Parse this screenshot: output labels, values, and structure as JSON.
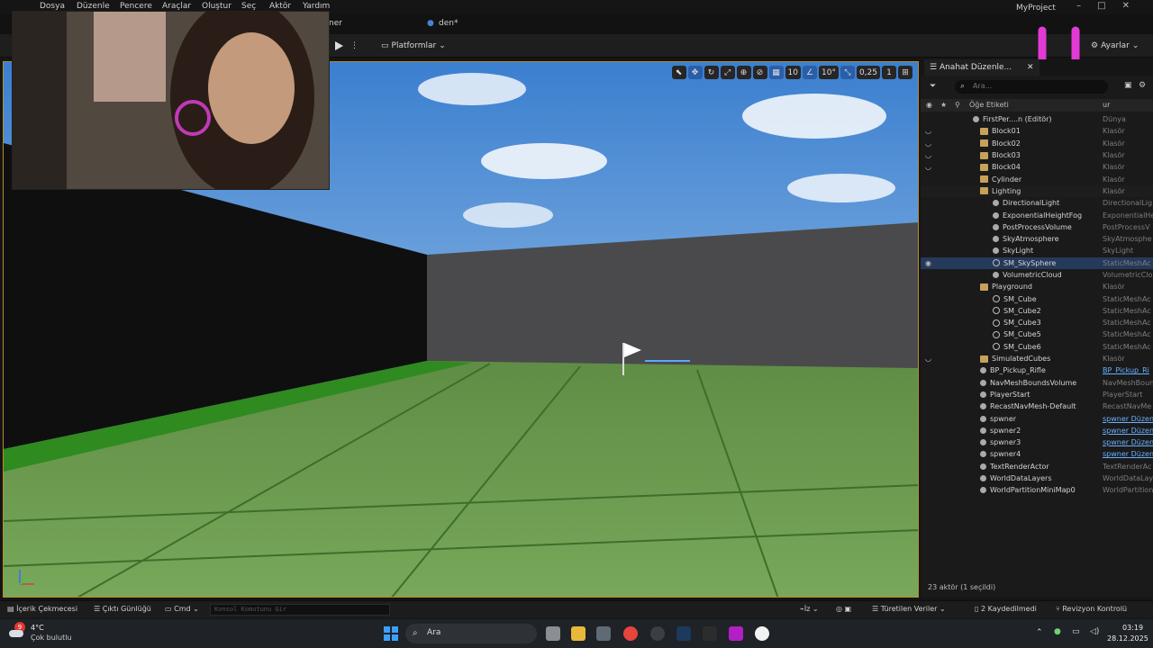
{
  "menu": {
    "items": [
      "Dosya",
      "Düzenle",
      "Pencere",
      "Araçlar",
      "Oluştur",
      "Seç",
      "Aktör",
      "Yardım"
    ],
    "project": "MyProject"
  },
  "tabs": {
    "map_tab": "ner",
    "level_tab": "den*"
  },
  "toolbar": {
    "platforms": "Platformlar",
    "settings": "Ayarlar"
  },
  "viewport": {
    "grid_value": "10",
    "angle_value": "10°",
    "scale_value": "0,25",
    "camera_speed": "1"
  },
  "outliner": {
    "tab_title": "Anahat Düzenle...",
    "search_placeholder": "Ara...",
    "col_label": "Öğe Etiketi",
    "col_type": "ur",
    "rows": [
      {
        "label": "FirstPer....n (Editör)",
        "type": "Dünya",
        "indent": 0,
        "icon": "world"
      },
      {
        "label": "Block01",
        "type": "Klasör",
        "indent": 1,
        "icon": "folder"
      },
      {
        "label": "Block02",
        "type": "Klasör",
        "indent": 1,
        "icon": "folder"
      },
      {
        "label": "Block03",
        "type": "Klasör",
        "indent": 1,
        "icon": "folder"
      },
      {
        "label": "Block04",
        "type": "Klasör",
        "indent": 1,
        "icon": "folder"
      },
      {
        "label": "Cylinder",
        "type": "Klasör",
        "indent": 1,
        "icon": "folder"
      },
      {
        "label": "Lighting",
        "type": "Klasör",
        "indent": 1,
        "icon": "folder"
      },
      {
        "label": "DirectionalLight",
        "type": "DirectionalLig",
        "indent": 2,
        "icon": "actor"
      },
      {
        "label": "ExponentialHeightFog",
        "type": "ExponentialHe",
        "indent": 2,
        "icon": "actor"
      },
      {
        "label": "PostProcessVolume",
        "type": "PostProcessV",
        "indent": 2,
        "icon": "actor"
      },
      {
        "label": "SkyAtmosphere",
        "type": "SkyAtmosphe",
        "indent": 2,
        "icon": "actor"
      },
      {
        "label": "SkyLight",
        "type": "SkyLight",
        "indent": 2,
        "icon": "actor"
      },
      {
        "label": "SM_SkySphere",
        "type": "StaticMeshAc",
        "indent": 2,
        "icon": "mesh"
      },
      {
        "label": "VolumetricCloud",
        "type": "VolumetricClo",
        "indent": 2,
        "icon": "actor"
      },
      {
        "label": "Playground",
        "type": "Klasör",
        "indent": 1,
        "icon": "folder"
      },
      {
        "label": "SM_Cube",
        "type": "StaticMeshAc",
        "indent": 2,
        "icon": "mesh"
      },
      {
        "label": "SM_Cube2",
        "type": "StaticMeshAc",
        "indent": 2,
        "icon": "mesh"
      },
      {
        "label": "SM_Cube3",
        "type": "StaticMeshAc",
        "indent": 2,
        "icon": "mesh"
      },
      {
        "label": "SM_Cube5",
        "type": "StaticMeshAc",
        "indent": 2,
        "icon": "mesh"
      },
      {
        "label": "SM_Cube6",
        "type": "StaticMeshAc",
        "indent": 2,
        "icon": "mesh"
      },
      {
        "label": "SimulatedCubes",
        "type": "Klasör",
        "indent": 1,
        "icon": "folder"
      },
      {
        "label": "BP_Pickup_Rifle",
        "type": "BP_Pickup_Ri",
        "indent": 1,
        "icon": "actor"
      },
      {
        "label": "NavMeshBoundsVolume",
        "type": "NavMeshBoun",
        "indent": 1,
        "icon": "actor"
      },
      {
        "label": "PlayerStart",
        "type": "PlayerStart",
        "indent": 1,
        "icon": "actor"
      },
      {
        "label": "RecastNavMesh-Default",
        "type": "RecastNavMe",
        "indent": 1,
        "icon": "actor"
      },
      {
        "label": "spwner",
        "type": "spwner Düzen",
        "indent": 1,
        "icon": "actor"
      },
      {
        "label": "spwner2",
        "type": "spwner Düzen",
        "indent": 1,
        "icon": "actor"
      },
      {
        "label": "spwner3",
        "type": "spwner Düzen",
        "indent": 1,
        "icon": "actor"
      },
      {
        "label": "spwner4",
        "type": "spwner Düzen",
        "indent": 1,
        "icon": "actor"
      },
      {
        "label": "TextRenderActor",
        "type": "TextRenderAc",
        "indent": 1,
        "icon": "actor"
      },
      {
        "label": "WorldDataLayers",
        "type": "WorldDataLay",
        "indent": 1,
        "icon": "actor"
      },
      {
        "label": "WorldPartitionMiniMap0",
        "type": "WorldPartition",
        "indent": 1,
        "icon": "actor"
      }
    ],
    "footer": "23 aktör (1 seçildi)"
  },
  "bottombar": {
    "content": "İçerik Çekmecesi",
    "output": "Çıktı Günlüğü",
    "cmd": "Cmd",
    "console_placeholder": "Konsol Komutunu Gir",
    "iz": "İz",
    "derived": "Türetilen Veriler",
    "unsaved": "2 Kaydedilmedi",
    "revision": "Revizyon Kontrolü"
  },
  "taskbar": {
    "temp": "4°C",
    "weather": "Çok bulutlu",
    "search": "Ara",
    "time": "03:19",
    "date": "28.12.2025",
    "badge": "9"
  }
}
